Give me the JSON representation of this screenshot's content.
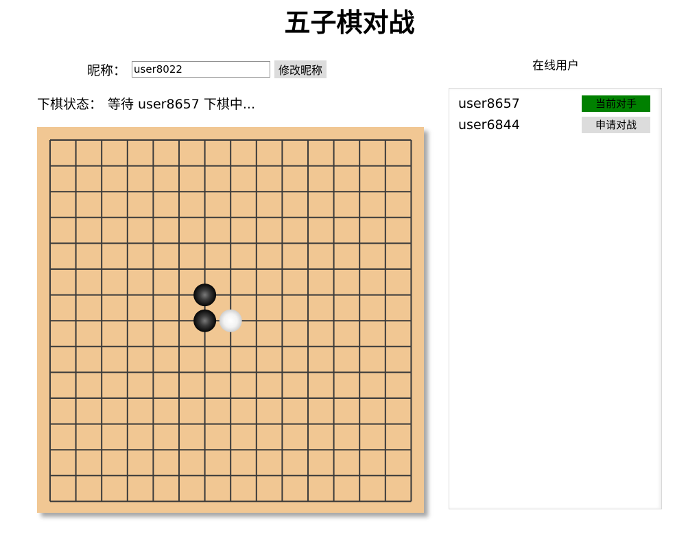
{
  "title": "五子棋对战",
  "nickname": {
    "label": "昵称：",
    "value": "user8022",
    "button_label": "修改昵称"
  },
  "status": {
    "label": "下棋状态：",
    "text": "等待 user8657 下棋中..."
  },
  "online": {
    "title": "在线用户",
    "users": [
      {
        "name": "user8657",
        "action_label": "当前对手",
        "action_color": "#008000"
      },
      {
        "name": "user6844",
        "action_label": "申请对战",
        "action_color": "#dcdcdc"
      }
    ]
  },
  "board": {
    "lines": 15,
    "background": "#f1c793",
    "line_color": "#3a3a3a",
    "stones": [
      {
        "color": "black",
        "col": 6,
        "row": 6
      },
      {
        "color": "black",
        "col": 6,
        "row": 7
      },
      {
        "color": "white",
        "col": 7,
        "row": 7
      }
    ]
  }
}
